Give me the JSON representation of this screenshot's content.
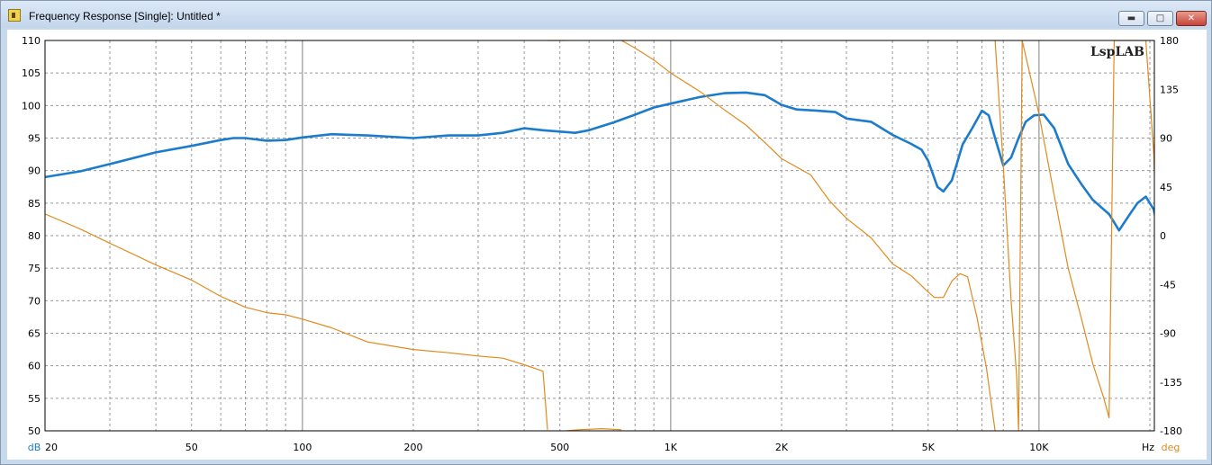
{
  "window": {
    "title": "Frequency Response [Single]: Untitled *",
    "buttons": {
      "minimize": "▬",
      "maximize": "□",
      "close": "✕"
    }
  },
  "chart_data": {
    "type": "line",
    "brand": "LspLAB",
    "x_scale": "log",
    "xlim": [
      20,
      20000
    ],
    "x_ticks": [
      {
        "value": 20,
        "label": "20"
      },
      {
        "value": 50,
        "label": "50"
      },
      {
        "value": 100,
        "label": "100"
      },
      {
        "value": 200,
        "label": "200"
      },
      {
        "value": 500,
        "label": "500"
      },
      {
        "value": 1000,
        "label": "1K"
      },
      {
        "value": 2000,
        "label": "2K"
      },
      {
        "value": 5000,
        "label": "5K"
      },
      {
        "value": 10000,
        "label": "10K"
      }
    ],
    "x_unit": "Hz",
    "y_left": {
      "unit": "dB",
      "lim": [
        50,
        110
      ],
      "ticks": [
        110,
        105,
        100,
        95,
        90,
        85,
        80,
        75,
        70,
        65,
        60,
        55,
        50
      ],
      "color": "#000000"
    },
    "y_right": {
      "unit": "deg",
      "lim": [
        -180,
        180
      ],
      "ticks": [
        180,
        135,
        90,
        45,
        0,
        -45,
        -90,
        -135,
        -180
      ],
      "color": "#e08a1e"
    },
    "grid": true,
    "series": [
      {
        "axis": "left",
        "color": "#1c7ccb",
        "points": [
          [
            20,
            89
          ],
          [
            25,
            89.9
          ],
          [
            30,
            91
          ],
          [
            40,
            92.8
          ],
          [
            50,
            93.8
          ],
          [
            60,
            94.7
          ],
          [
            65,
            95
          ],
          [
            70,
            95
          ],
          [
            80,
            94.6
          ],
          [
            90,
            94.7
          ],
          [
            100,
            95.1
          ],
          [
            120,
            95.6
          ],
          [
            150,
            95.4
          ],
          [
            200,
            95
          ],
          [
            250,
            95.4
          ],
          [
            300,
            95.4
          ],
          [
            350,
            95.8
          ],
          [
            400,
            96.5
          ],
          [
            450,
            96.2
          ],
          [
            500,
            96
          ],
          [
            550,
            95.8
          ],
          [
            600,
            96.2
          ],
          [
            700,
            97.4
          ],
          [
            800,
            98.6
          ],
          [
            900,
            99.7
          ],
          [
            1000,
            100.3
          ],
          [
            1200,
            101.3
          ],
          [
            1400,
            101.9
          ],
          [
            1600,
            102
          ],
          [
            1800,
            101.6
          ],
          [
            2000,
            100.1
          ],
          [
            2200,
            99.4
          ],
          [
            2500,
            99.2
          ],
          [
            2800,
            99
          ],
          [
            3000,
            98
          ],
          [
            3500,
            97.5
          ],
          [
            4000,
            95.5
          ],
          [
            4500,
            94.1
          ],
          [
            4800,
            93.2
          ],
          [
            5000,
            91.5
          ],
          [
            5300,
            87.5
          ],
          [
            5500,
            86.8
          ],
          [
            5800,
            88.5
          ],
          [
            6200,
            94
          ],
          [
            6600,
            96.6
          ],
          [
            7000,
            99.2
          ],
          [
            7300,
            98.5
          ],
          [
            7600,
            95
          ],
          [
            8000,
            90.8
          ],
          [
            8400,
            92
          ],
          [
            8800,
            95
          ],
          [
            9200,
            97.5
          ],
          [
            9700,
            98.5
          ],
          [
            10300,
            98.6
          ],
          [
            11000,
            96.5
          ],
          [
            12000,
            91
          ],
          [
            13000,
            88
          ],
          [
            14000,
            85.5
          ],
          [
            15500,
            83.3
          ],
          [
            16500,
            80.8
          ],
          [
            17500,
            83
          ],
          [
            18500,
            85
          ],
          [
            19500,
            86
          ],
          [
            20500,
            84
          ],
          [
            21000,
            81
          ],
          [
            21300,
            78
          ],
          [
            21500,
            72
          ]
        ]
      },
      {
        "axis": "right",
        "color": "#e08a1e",
        "points": [
          [
            20,
            20
          ],
          [
            25,
            6
          ],
          [
            30,
            -7
          ],
          [
            40,
            -27
          ],
          [
            50,
            -41
          ],
          [
            60,
            -56
          ],
          [
            70,
            -66
          ],
          [
            80,
            -71
          ],
          [
            90,
            -73
          ],
          [
            100,
            -77
          ],
          [
            120,
            -85
          ],
          [
            150,
            -98
          ],
          [
            200,
            -105
          ],
          [
            250,
            -108
          ],
          [
            300,
            -111
          ],
          [
            350,
            -113
          ],
          [
            400,
            -119
          ],
          [
            450,
            -125
          ],
          [
            463,
            -179
          ],
          [
            463,
            180
          ],
          [
            520,
            180
          ],
          [
            520,
            -180
          ],
          [
            560,
            -179
          ],
          [
            650,
            -178
          ],
          [
            735,
            -179
          ],
          [
            735,
            180
          ],
          [
            800,
            173
          ],
          [
            900,
            162
          ],
          [
            1000,
            150
          ],
          [
            1200,
            133
          ],
          [
            1400,
            116
          ],
          [
            1600,
            102
          ],
          [
            1800,
            86
          ],
          [
            2000,
            71
          ],
          [
            2400,
            56
          ],
          [
            2700,
            32
          ],
          [
            3000,
            16
          ],
          [
            3500,
            -2
          ],
          [
            4000,
            -26
          ],
          [
            4500,
            -37
          ],
          [
            5000,
            -52
          ],
          [
            5200,
            -57
          ],
          [
            5500,
            -57
          ],
          [
            5800,
            -42
          ],
          [
            6100,
            -35
          ],
          [
            6400,
            -38
          ],
          [
            6800,
            -77
          ],
          [
            7200,
            -122
          ],
          [
            7600,
            -180
          ],
          [
            7600,
            180
          ],
          [
            8000,
            65
          ],
          [
            8400,
            -60
          ],
          [
            8700,
            -130
          ],
          [
            8800,
            -180
          ],
          [
            9000,
            180
          ],
          [
            10000,
            112
          ],
          [
            11000,
            37
          ],
          [
            12000,
            -30
          ],
          [
            13000,
            -75
          ],
          [
            14000,
            -118
          ],
          [
            15000,
            -150
          ],
          [
            15500,
            -168
          ],
          [
            16000,
            180
          ],
          [
            19500,
            180
          ],
          [
            20500,
            75
          ],
          [
            21000,
            -45
          ]
        ]
      }
    ]
  }
}
